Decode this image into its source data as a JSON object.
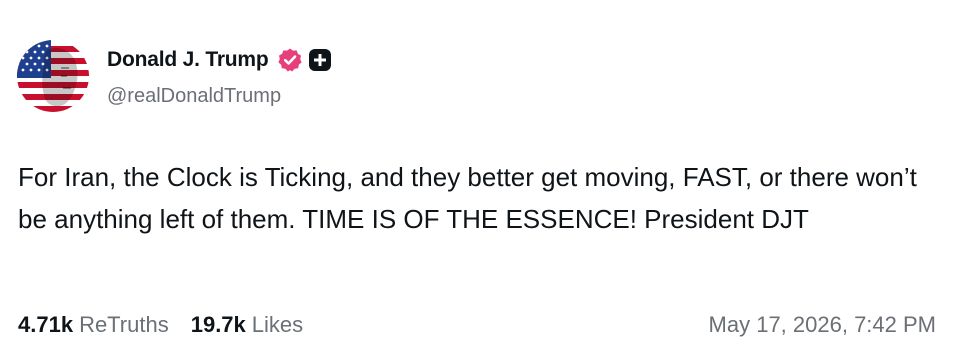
{
  "author": {
    "display_name": "Donald J. Trump",
    "handle": "@realDonaldTrump",
    "avatar_icon": "flag-face-avatar",
    "verified_icon": "verified-badge-icon",
    "plus_icon": "plus-badge-icon"
  },
  "post": {
    "text": "For Iran, the Clock is Ticking, and they better get moving, FAST, or there won’t be anything left of them. TIME IS OF THE ESSENCE! President DJT",
    "timestamp": "May 17, 2026, 7:42 PM"
  },
  "stats": {
    "retruths_count": "4.71k",
    "retruths_label": "ReTruths",
    "likes_count": "19.7k",
    "likes_label": "Likes"
  },
  "colors": {
    "text": "#0f1419",
    "muted": "#6b6f76",
    "verified": "#e5407b",
    "plus_badge": "#0f1419"
  }
}
